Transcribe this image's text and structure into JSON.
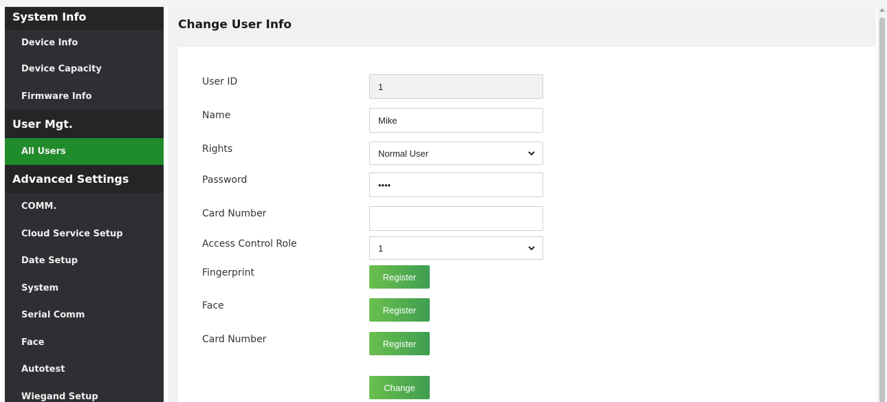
{
  "sidebar": {
    "section_system": "System Info",
    "system_items": [
      "Device Info",
      "Device Capacity",
      "Firmware Info"
    ],
    "section_user": "User Mgt.",
    "user_items": [
      "All Users"
    ],
    "section_advanced": "Advanced Settings",
    "advanced_items": [
      "COMM.",
      "Cloud Service Setup",
      "Date Setup",
      "System",
      "Serial Comm",
      "Face",
      "Autotest",
      "Wiegand Setup"
    ],
    "active_item": "All Users",
    "active_color": "#1f8b2a"
  },
  "main": {
    "title": "Change User Info",
    "form": {
      "user_id_label": "User ID",
      "user_id_value": "1",
      "name_label": "Name",
      "name_value": "Mike",
      "rights_label": "Rights",
      "rights_value": "Normal User",
      "password_label": "Password",
      "password_value": "••••",
      "card_number_label": "Card Number",
      "card_number_value": "",
      "access_role_label": "Access Control Role",
      "access_role_value": "1",
      "fingerprint_label": "Fingerprint",
      "face_label": "Face",
      "card_register_label": "Card Number",
      "register_button": "Register",
      "change_button": "Change"
    }
  },
  "icons": {
    "dropdown": "chevron-down-icon",
    "scroll_up": "scroll-up-arrow-icon"
  }
}
